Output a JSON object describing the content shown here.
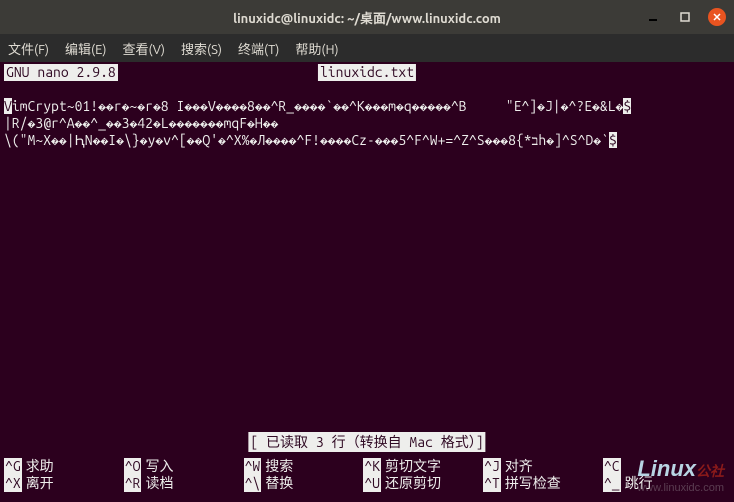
{
  "window": {
    "title": "linuxidc@linuxidc: ~/桌面/www.linuxidc.com"
  },
  "menubar": {
    "file": "文件(F)",
    "edit": "编辑(E)",
    "view": "查看(V)",
    "search": "搜索(S)",
    "terminal": "终端(T)",
    "help": "帮助(H)"
  },
  "nano": {
    "version": "GNU nano 2.9.8",
    "filename": "linuxidc.txt",
    "content_line1_a": "V",
    "content_line1_b": "imCrypt~01!��r�~�r�8 I���V����8��^R_����`��^K���m�q�����^B     \"E^]�J|�^?E�&L�",
    "content_line1_end": "$",
    "content_line2": "|R/�3@r^A��^_��3�42�L�������mqF�H��",
    "content_line3": "\\(\"M~X��|ԦN��I�\\}�y�v^[��Q'�^X%�Л����^F!����Cz-���5^F^W+=^Z^S���ב*}8h�]^S^D�`",
    "content_line3_end": "$",
    "status": "[ 已读取 3 行（转换自 Mac 格式）]"
  },
  "shortcuts": {
    "row1": [
      {
        "key": "^G",
        "label": "求助"
      },
      {
        "key": "^O",
        "label": "写入"
      },
      {
        "key": "^W",
        "label": "搜索"
      },
      {
        "key": "^K",
        "label": "剪切文字"
      },
      {
        "key": "^J",
        "label": "对齐"
      },
      {
        "key": "^C",
        "label": ""
      }
    ],
    "row2": [
      {
        "key": "^X",
        "label": "离开"
      },
      {
        "key": "^R",
        "label": "读档"
      },
      {
        "key": "^\\",
        "label": "替换"
      },
      {
        "key": "^U",
        "label": "还原剪切"
      },
      {
        "key": "^T",
        "label": "拼写检查"
      },
      {
        "key": "^_",
        "label": "跳行"
      }
    ]
  },
  "watermark": {
    "brand1": "Linux",
    "brand2": "公社",
    "url": "www.linuxidc.com"
  }
}
